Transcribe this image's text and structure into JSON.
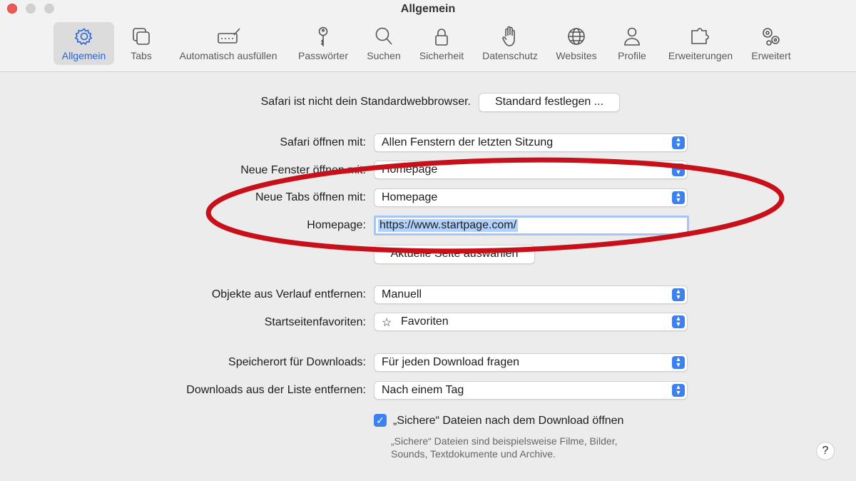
{
  "window": {
    "title": "Allgemein"
  },
  "tabs": [
    {
      "label": "Allgemein",
      "icon": "gear-icon",
      "active": true
    },
    {
      "label": "Tabs",
      "icon": "tabs-icon"
    },
    {
      "label": "Automatisch ausfüllen",
      "icon": "autofill-icon"
    },
    {
      "label": "Passwörter",
      "icon": "key-icon"
    },
    {
      "label": "Suchen",
      "icon": "search-icon"
    },
    {
      "label": "Sicherheit",
      "icon": "lock-icon"
    },
    {
      "label": "Datenschutz",
      "icon": "hand-icon"
    },
    {
      "label": "Websites",
      "icon": "globe-icon"
    },
    {
      "label": "Profile",
      "icon": "person-icon"
    },
    {
      "label": "Erweiterungen",
      "icon": "puzzle-icon"
    },
    {
      "label": "Erweitert",
      "icon": "gears-icon"
    }
  ],
  "default_browser": {
    "text": "Safari ist nicht dein Standardwebbrowser.",
    "button": "Standard festlegen ..."
  },
  "settings": {
    "open_with": {
      "label": "Safari öffnen mit:",
      "value": "Allen Fenstern der letzten Sitzung"
    },
    "new_windows": {
      "label": "Neue Fenster öffnen mit:",
      "value": "Homepage"
    },
    "new_tabs": {
      "label": "Neue Tabs öffnen mit:",
      "value": "Homepage"
    },
    "homepage": {
      "label": "Homepage:",
      "value": "https://www.startpage.com/"
    },
    "current_page_button": "Aktuelle Seite auswählen",
    "remove_history": {
      "label": "Objekte aus Verlauf entfernen:",
      "value": "Manuell"
    },
    "favorites": {
      "label": "Startseitenfavoriten:",
      "value": "Favoriten",
      "icon": "star-icon"
    },
    "download_location": {
      "label": "Speicherort für Downloads:",
      "value": "Für jeden Download fragen"
    },
    "remove_downloads": {
      "label": "Downloads aus der Liste entfernen:",
      "value": "Nach einem Tag"
    },
    "safe_files": {
      "label": "„Sichere“ Dateien nach dem Download öffnen",
      "checked": true,
      "note_line1": "„Sichere“ Dateien sind beispielsweise Filme, Bilder,",
      "note_line2": "Sounds, Textdokumente und Archive."
    }
  },
  "help_label": "?",
  "colors": {
    "accent": "#3b82f0",
    "annotation": "#c8101a"
  }
}
